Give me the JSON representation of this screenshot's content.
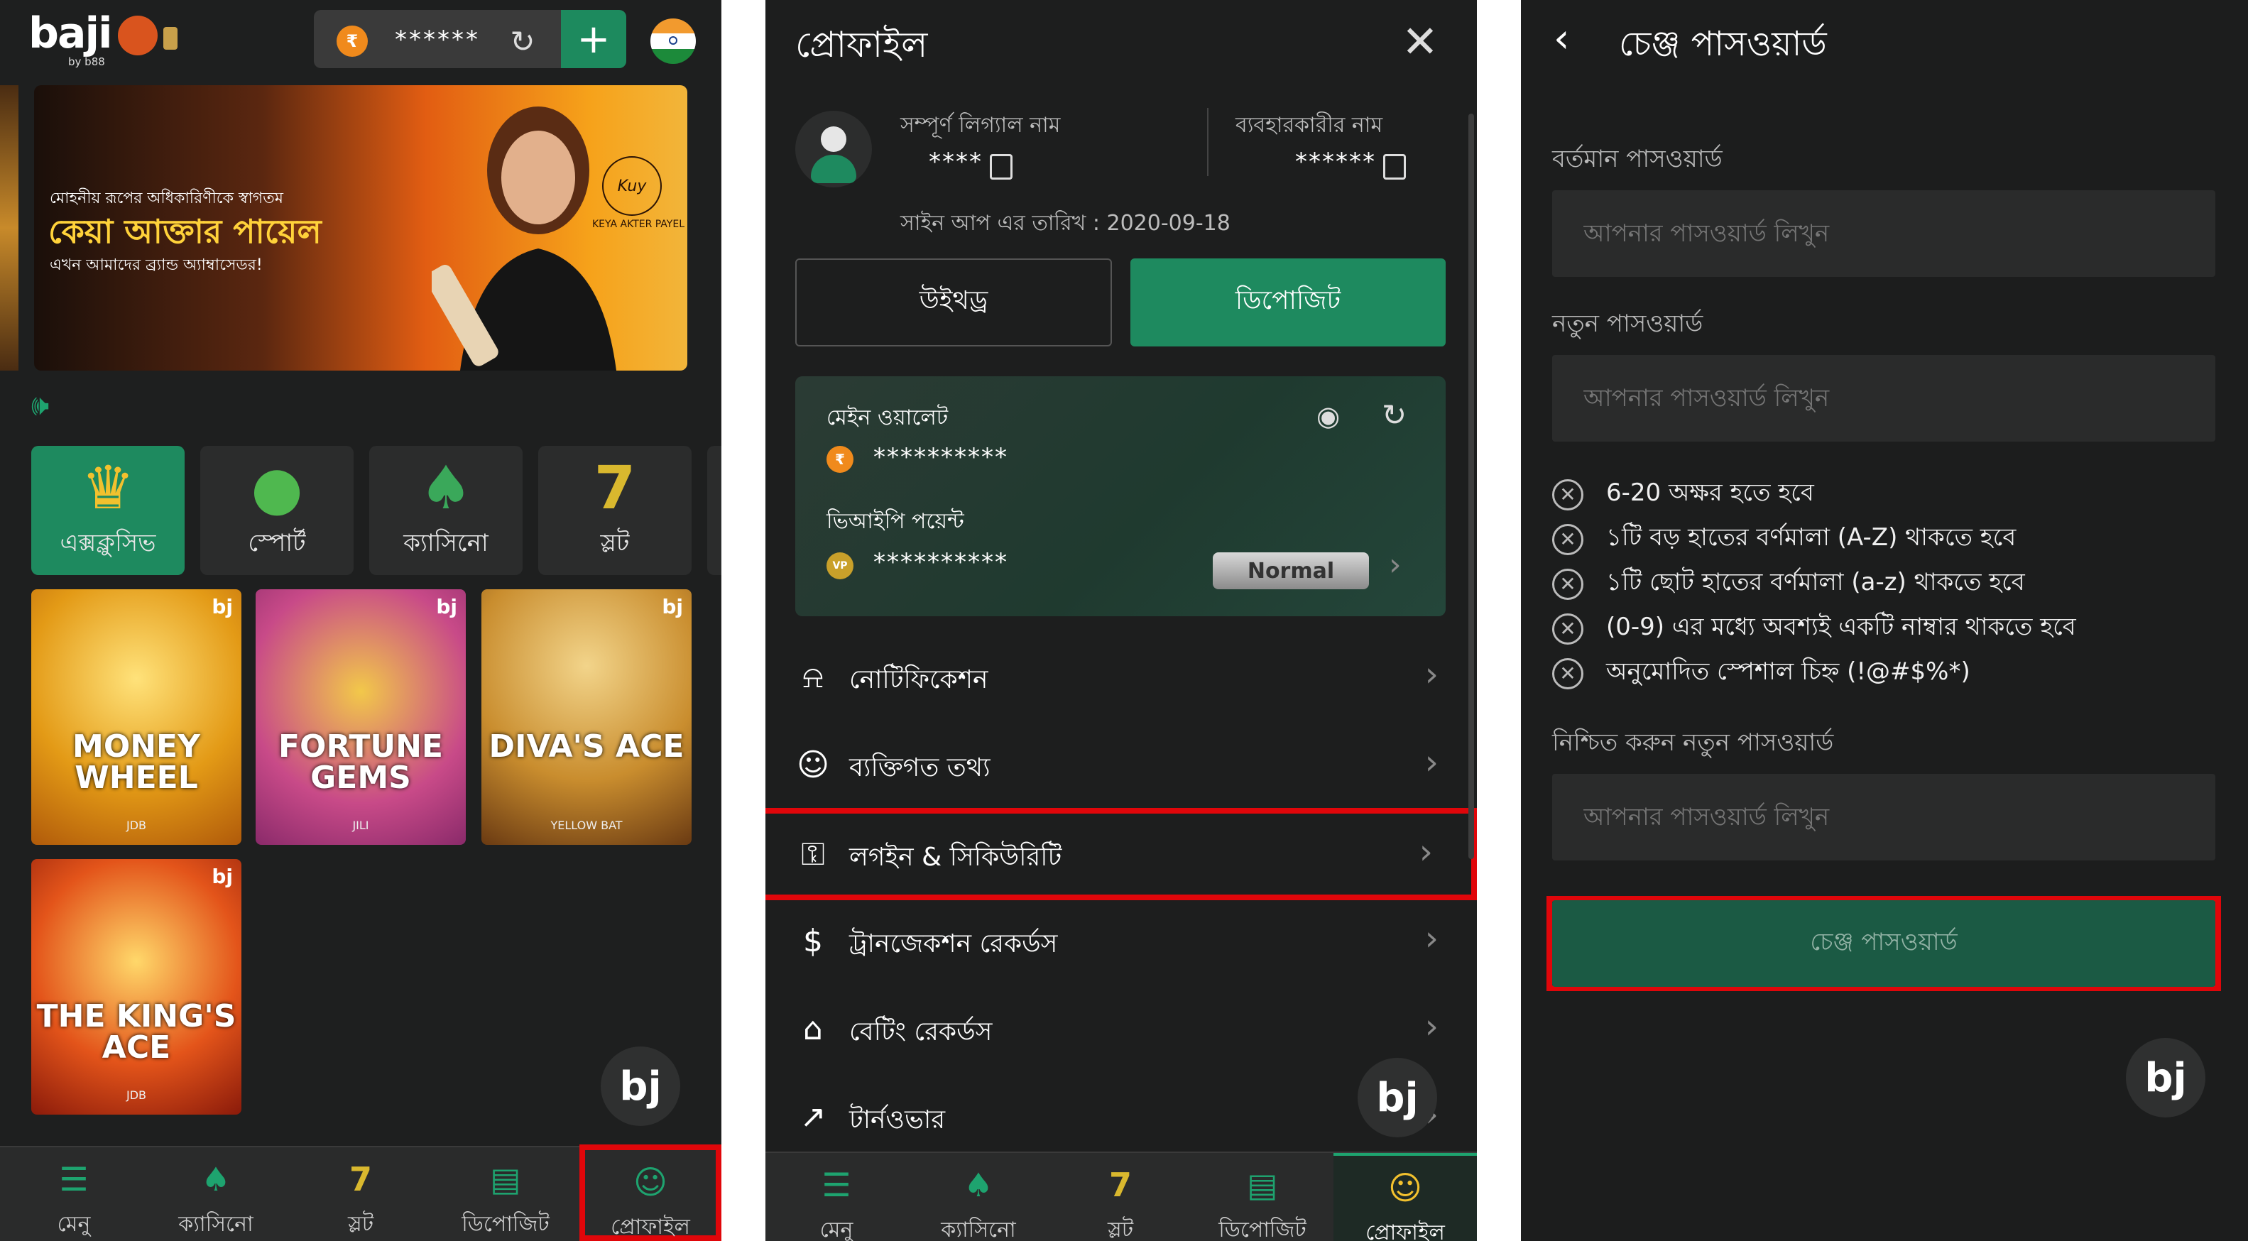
{
  "panel1": {
    "logo": "baji",
    "logo_sub": "by b88",
    "balance": "******",
    "currency_symbol": "₹",
    "banner": {
      "small_text": "মোহনীয় রূপের অধিকারিণীকে স্বাগতম",
      "title": "কেয়া আক্তার পায়েল",
      "subtitle": "এখন আমাদের ব্র্যান্ড অ্যাম্বাসেডর!",
      "signature_name": "KEYA AKTER PAYEL"
    },
    "categories": [
      {
        "label": "এক্সক্লুসিভ",
        "icon": "crown-icon"
      },
      {
        "label": "স্পোর্ট",
        "icon": "cricket-ball-icon"
      },
      {
        "label": "ক্যাসিনো",
        "icon": "spade-icon"
      },
      {
        "label": "স্লট",
        "icon": "seven-icon"
      }
    ],
    "games": [
      {
        "title": "MONEY WHEEL",
        "provider": "JDB",
        "color": "#e8a21a"
      },
      {
        "title": "FORTUNE GEMS",
        "provider": "JILI",
        "color": "#c2407a"
      },
      {
        "title": "DIVA'S ACE",
        "provider": "YELLOW BAT",
        "color": "#c98d2e"
      },
      {
        "title": "THE KING'S ACE",
        "provider": "JDB",
        "color": "#d9481a"
      }
    ],
    "nav": [
      "মেনু",
      "ক্যাসিনো",
      "স্লট",
      "ডিপোজিট",
      "প্রোফাইল"
    ]
  },
  "panel2": {
    "title": "প্রোফাইল",
    "legal_name_label": "সম্পূর্ণ লিগ্যাল নাম",
    "legal_name_value": "****",
    "username_label": "ব্যবহারকারীর নাম",
    "username_value": "******",
    "signup_date": "সাইন আপ এর তারিখ : 2020-09-18",
    "withdraw": "উইথড্র",
    "deposit": "ডিপোজিট",
    "main_wallet_label": "মেইন ওয়ালেট",
    "main_wallet_value": "**********",
    "vip_label": "ভিআইপি পয়েন্ট",
    "vip_value": "**********",
    "vip_level": "Normal",
    "menu": [
      {
        "label": "নোটিফিকেশন",
        "icon": "bell-icon"
      },
      {
        "label": "ব্যক্তিগত তথ্য",
        "icon": "user-circle-icon"
      },
      {
        "label": "লগইন & সিকিউরিটি",
        "icon": "lock-icon"
      },
      {
        "label": "ট্রানজেকশন রেকর্ডস",
        "icon": "dollar-doc-icon"
      },
      {
        "label": "বেটিং রেকর্ডস",
        "icon": "betting-doc-icon"
      },
      {
        "label": "টার্নওভার",
        "icon": "chart-icon"
      }
    ],
    "nav": [
      "মেনু",
      "ক্যাসিনো",
      "স্লট",
      "ডিপোজিট",
      "প্রোফাইল"
    ]
  },
  "panel3": {
    "title": "চেঞ্জ পাসওয়ার্ড",
    "current_label": "বর্তমান পাসওয়ার্ড",
    "new_label": "নতুন পাসওয়ার্ড",
    "confirm_label": "নিশ্চিত করুন নতুন পাসওয়ার্ড",
    "placeholder": "আপনার পাসওয়ার্ড লিখুন",
    "rules": [
      "6-20 অক্ষর হতে হবে",
      "১টি বড় হাতের বর্ণমালা (A-Z) থাকতে হবে",
      "১টি ছোট হাতের বর্ণমালা (a-z) থাকতে হবে",
      "(0-9) এর মধ্যে অবশ্যই একটি নাম্বার থাকতে হবে",
      "অনুমোদিত স্পেশাল চিহ্ন (!@#$%*)"
    ],
    "submit": "চেঞ্জ পাসওয়ার্ড"
  },
  "colors": {
    "accent": "#1e8a5f",
    "highlight": "#e0060a",
    "bg": "#1e1f1f"
  }
}
